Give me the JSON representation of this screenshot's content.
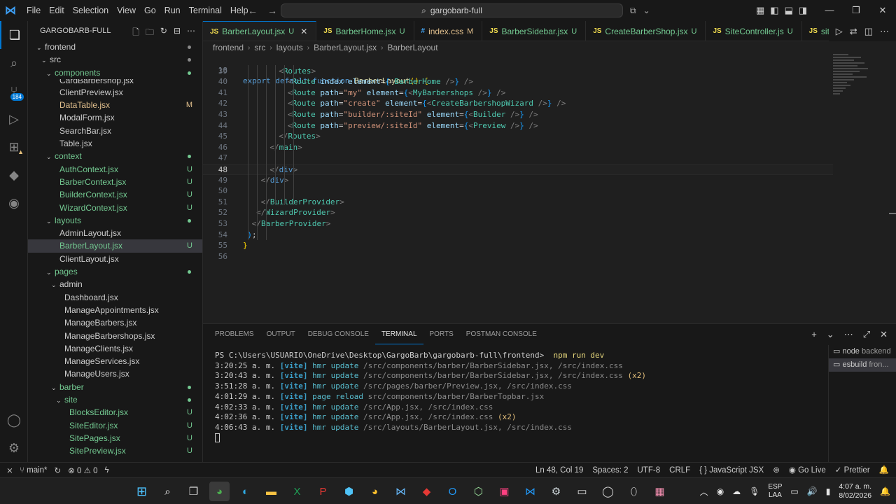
{
  "titlebar": {
    "menu": [
      "File",
      "Edit",
      "Selection",
      "View",
      "Go",
      "Run",
      "Terminal",
      "Help"
    ],
    "search": "gargobarb-full"
  },
  "activity": {
    "scm_badge": "184"
  },
  "sidebar": {
    "title": "GARGOBARB-FULL",
    "rows": [
      {
        "name": "frontend",
        "indent": 0,
        "chev": "⌄",
        "kind": "folder",
        "dot": "#8a8a8a"
      },
      {
        "name": "src",
        "indent": 1,
        "chev": "⌄",
        "kind": "folder",
        "dot": "#8a8a8a"
      },
      {
        "name": "components",
        "indent": 2,
        "chev": "⌄",
        "kind": "folder",
        "dot": "#73c991"
      },
      {
        "name": "CardBarbershop.jsx",
        "indent": 3,
        "chev": "",
        "kind": "file",
        "partial": true
      },
      {
        "name": "ClientPreview.jsx",
        "indent": 3,
        "chev": "",
        "kind": "file"
      },
      {
        "name": "DataTable.jsx",
        "indent": 3,
        "chev": "",
        "kind": "mod",
        "stat": "M"
      },
      {
        "name": "ModalForm.jsx",
        "indent": 3,
        "chev": "",
        "kind": "file"
      },
      {
        "name": "SearchBar.jsx",
        "indent": 3,
        "chev": "",
        "kind": "file"
      },
      {
        "name": "Table.jsx",
        "indent": 3,
        "chev": "",
        "kind": "file"
      },
      {
        "name": "context",
        "indent": 2,
        "chev": "⌄",
        "kind": "folder",
        "dot": "#73c991"
      },
      {
        "name": "AuthContext.jsx",
        "indent": 3,
        "chev": "",
        "kind": "new",
        "stat": "U"
      },
      {
        "name": "BarberContext.jsx",
        "indent": 3,
        "chev": "",
        "kind": "new",
        "stat": "U"
      },
      {
        "name": "BuilderContext.jsx",
        "indent": 3,
        "chev": "",
        "kind": "new",
        "stat": "U"
      },
      {
        "name": "WizardContext.jsx",
        "indent": 3,
        "chev": "",
        "kind": "new",
        "stat": "U"
      },
      {
        "name": "layouts",
        "indent": 2,
        "chev": "⌄",
        "kind": "folder",
        "dot": "#73c991"
      },
      {
        "name": "AdminLayout.jsx",
        "indent": 3,
        "chev": "",
        "kind": "file"
      },
      {
        "name": "BarberLayout.jsx",
        "indent": 3,
        "chev": "",
        "kind": "new",
        "stat": "U",
        "selected": true
      },
      {
        "name": "ClientLayout.jsx",
        "indent": 3,
        "chev": "",
        "kind": "file"
      },
      {
        "name": "pages",
        "indent": 2,
        "chev": "⌄",
        "kind": "folder",
        "dot": "#73c991"
      },
      {
        "name": "admin",
        "indent": 3,
        "chev": "⌄",
        "kind": "folder"
      },
      {
        "name": "Dashboard.jsx",
        "indent": 4,
        "chev": "",
        "kind": "file"
      },
      {
        "name": "ManageAppointments.jsx",
        "indent": 4,
        "chev": "",
        "kind": "file"
      },
      {
        "name": "ManageBarbers.jsx",
        "indent": 4,
        "chev": "",
        "kind": "file"
      },
      {
        "name": "ManageBarbershops.jsx",
        "indent": 4,
        "chev": "",
        "kind": "file"
      },
      {
        "name": "ManageClients.jsx",
        "indent": 4,
        "chev": "",
        "kind": "file"
      },
      {
        "name": "ManageServices.jsx",
        "indent": 4,
        "chev": "",
        "kind": "file"
      },
      {
        "name": "ManageUsers.jsx",
        "indent": 4,
        "chev": "",
        "kind": "file"
      },
      {
        "name": "barber",
        "indent": 3,
        "chev": "⌄",
        "kind": "folder",
        "dot": "#73c991"
      },
      {
        "name": "site",
        "indent": 4,
        "chev": "⌄",
        "kind": "folder",
        "dot": "#73c991"
      },
      {
        "name": "BlocksEditor.jsx",
        "indent": 5,
        "chev": "",
        "kind": "new",
        "stat": "U"
      },
      {
        "name": "SiteEditor.jsx",
        "indent": 5,
        "chev": "",
        "kind": "new",
        "stat": "U"
      },
      {
        "name": "SitePages.jsx",
        "indent": 5,
        "chev": "",
        "kind": "new",
        "stat": "U"
      },
      {
        "name": "SitePreview.jsx",
        "indent": 5,
        "chev": "",
        "kind": "new",
        "stat": "U"
      }
    ]
  },
  "tabs": [
    {
      "label": "BarberLayout.jsx",
      "status": "U",
      "icon": "JS",
      "kind": "new",
      "active": true
    },
    {
      "label": "BarberHome.jsx",
      "status": "U",
      "icon": "JS",
      "kind": "new"
    },
    {
      "label": "index.css",
      "status": "M",
      "icon": "#",
      "kind": "mod"
    },
    {
      "label": "BarberSidebar.jsx",
      "status": "U",
      "icon": "JS",
      "kind": "new"
    },
    {
      "label": "CreateBarberShop.jsx",
      "status": "U",
      "icon": "JS",
      "kind": "new"
    },
    {
      "label": "SiteController.js",
      "status": "U",
      "icon": "JS",
      "kind": "new"
    },
    {
      "label": "site.route",
      "status": "",
      "icon": "JS",
      "kind": "new"
    }
  ],
  "breadcrumb": [
    "frontend",
    "src",
    "layouts",
    "BarberLayout.jsx",
    "BarberLayout"
  ],
  "editor": {
    "sticky_line": "18",
    "lines": [
      {
        "n": "39",
        "indent": 8,
        "html": "<span class='tgp'>&lt;</span><span class='tg'>Routes</span><span class='tgp'>&gt;</span>"
      },
      {
        "n": "40",
        "indent": 10,
        "html": "<span class='tgp'>&lt;</span><span class='tg'>Route</span> <span class='at'>index</span> <span class='at'>element</span>=<span class='br2'>{</span><span class='tgp'>&lt;</span><span class='tg'>BarberHome</span> <span class='tgp'>/&gt;</span><span class='br2'>}</span> <span class='tgp'>/&gt;</span>"
      },
      {
        "n": "41",
        "indent": 10,
        "html": "<span class='tgp'>&lt;</span><span class='tg'>Route</span> <span class='at'>path</span>=<span class='st'>\"my\"</span> <span class='at'>element</span>=<span class='br2'>{</span><span class='tgp'>&lt;</span><span class='tg'>MyBarbershops</span> <span class='tgp'>/&gt;</span><span class='br2'>}</span> <span class='tgp'>/&gt;</span>"
      },
      {
        "n": "42",
        "indent": 10,
        "html": "<span class='tgp'>&lt;</span><span class='tg'>Route</span> <span class='at'>path</span>=<span class='st'>\"create\"</span> <span class='at'>element</span>=<span class='br2'>{</span><span class='tgp'>&lt;</span><span class='tg'>CreateBarbershopWizard</span> <span class='tgp'>/&gt;</span><span class='br2'>}</span> <span class='tgp'>/&gt;</span>"
      },
      {
        "n": "43",
        "indent": 10,
        "html": "<span class='tgp'>&lt;</span><span class='tg'>Route</span> <span class='at'>path</span>=<span class='st'>\"builder/:siteId\"</span> <span class='at'>element</span>=<span class='br2'>{</span><span class='tgp'>&lt;</span><span class='tg'>Builder</span> <span class='tgp'>/&gt;</span><span class='br2'>}</span> <span class='tgp'>/&gt;</span>"
      },
      {
        "n": "44",
        "indent": 10,
        "html": "<span class='tgp'>&lt;</span><span class='tg'>Route</span> <span class='at'>path</span>=<span class='st'>\"preview/:siteId\"</span> <span class='at'>element</span>=<span class='br2'>{</span><span class='tgp'>&lt;</span><span class='tg'>Preview</span> <span class='tgp'>/&gt;</span><span class='br2'>}</span> <span class='tgp'>/&gt;</span>"
      },
      {
        "n": "45",
        "indent": 8,
        "html": "<span class='tgp'>&lt;/</span><span class='tg'>Routes</span><span class='tgp'>&gt;</span>"
      },
      {
        "n": "46",
        "indent": 6,
        "html": "<span class='tgp'>&lt;/</span><span class='tg'>main</span><span class='tgp'>&gt;</span>"
      },
      {
        "n": "47",
        "indent": 0,
        "html": ""
      },
      {
        "n": "48",
        "indent": 6,
        "html": "<span class='tgp'>&lt;/</span><span class='kw'>div</span><span class='tgp'>&gt;</span>",
        "current": true
      },
      {
        "n": "49",
        "indent": 4,
        "html": "<span class='tgp'>&lt;/</span><span class='kw'>div</span><span class='tgp'>&gt;</span>"
      },
      {
        "n": "50",
        "indent": 0,
        "html": ""
      },
      {
        "n": "51",
        "indent": 4,
        "html": "<span class='tgp'>&lt;/</span><span class='tg'>BuilderProvider</span><span class='tgp'>&gt;</span>"
      },
      {
        "n": "52",
        "indent": 3,
        "html": "<span class='tgp'>&lt;/</span><span class='tg'>WizardProvider</span><span class='tgp'>&gt;</span>"
      },
      {
        "n": "53",
        "indent": 2,
        "html": "<span class='tgp'>&lt;/</span><span class='tg'>BarberProvider</span><span class='tgp'>&gt;</span>"
      },
      {
        "n": "54",
        "indent": 1,
        "html": "<span class='br2'>)</span>;"
      },
      {
        "n": "55",
        "indent": 0,
        "html": "<span class='br3'>}</span>"
      },
      {
        "n": "56",
        "indent": 0,
        "html": ""
      }
    ]
  },
  "panel": {
    "tabs": [
      "PROBLEMS",
      "OUTPUT",
      "DEBUG CONSOLE",
      "TERMINAL",
      "PORTS",
      "POSTMAN CONSOLE"
    ],
    "active_tab": "TERMINAL",
    "prompt": "PS C:\\Users\\USUARIO\\OneDrive\\Desktop\\GargoBarb\\gargobarb-full\\frontend>",
    "command": "npm run dev",
    "log": [
      {
        "time": "3:20:25 a. m.",
        "tag": "[vite]",
        "action": "hmr update",
        "paths": "/src/components/barber/BarberSidebar.jsx, /src/index.css",
        "extra": ""
      },
      {
        "time": "3:20:43 a. m.",
        "tag": "[vite]",
        "action": "hmr update",
        "paths": "/src/components/barber/BarberSidebar.jsx, /src/index.css",
        "extra": "(x2)"
      },
      {
        "time": "3:51:28 a. m.",
        "tag": "[vite]",
        "action": "hmr update",
        "paths": "/src/pages/barber/Preview.jsx, /src/index.css",
        "extra": ""
      },
      {
        "time": "4:01:29 a. m.",
        "tag": "[vite]",
        "action": "page reload",
        "paths": "src/components/barber/BarberTopbar.jsx",
        "extra": ""
      },
      {
        "time": "4:02:33 a. m.",
        "tag": "[vite]",
        "action": "hmr update",
        "paths": "/src/App.jsx, /src/index.css",
        "extra": ""
      },
      {
        "time": "4:02:36 a. m.",
        "tag": "[vite]",
        "action": "hmr update",
        "paths": "/src/App.jsx, /src/index.css",
        "extra": "(x2)"
      },
      {
        "time": "4:06:43 a. m.",
        "tag": "[vite]",
        "action": "hmr update",
        "paths": "/src/layouts/BarberLayout.jsx, /src/index.css",
        "extra": ""
      }
    ],
    "terminals": [
      {
        "name": "node",
        "sub": "backend"
      },
      {
        "name": "esbuild",
        "sub": "fron..."
      }
    ]
  },
  "statusbar": {
    "branch": "main*",
    "errors": "0",
    "warnings": "0",
    "position": "Ln 48, Col 19",
    "spaces": "Spaces: 2",
    "encoding": "UTF-8",
    "eol": "CRLF",
    "language": "JavaScript JSX",
    "golive": "Go Live",
    "prettier": "Prettier"
  },
  "taskbar": {
    "lang_top": "ESP",
    "lang_bottom": "LAA",
    "time": "4:07 a. m.",
    "date": "8/02/2026"
  }
}
